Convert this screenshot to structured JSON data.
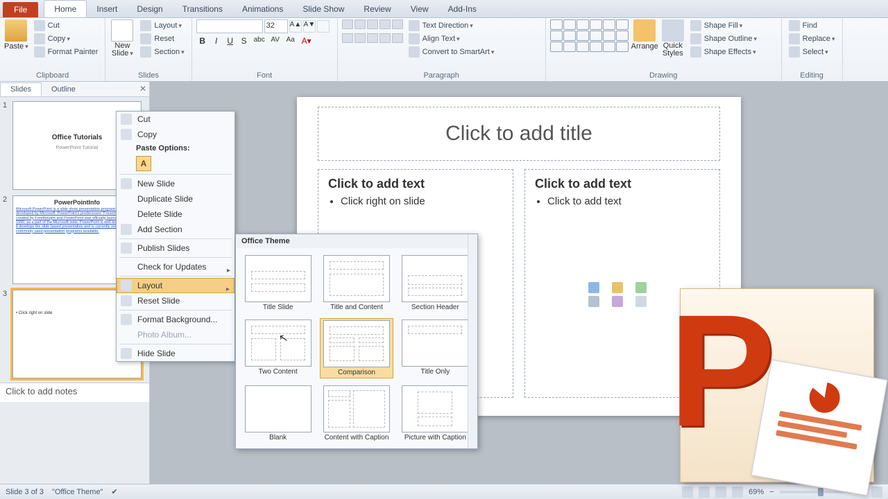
{
  "tabs": {
    "file": "File",
    "home": "Home",
    "insert": "Insert",
    "design": "Design",
    "transitions": "Transitions",
    "animations": "Animations",
    "slideshow": "Slide Show",
    "review": "Review",
    "view": "View",
    "addins": "Add-Ins"
  },
  "ribbon": {
    "clipboard": {
      "paste": "Paste",
      "cut": "Cut",
      "copy": "Copy",
      "painter": "Format Painter",
      "label": "Clipboard"
    },
    "slides": {
      "newslide": "New Slide",
      "layout": "Layout",
      "reset": "Reset",
      "section": "Section",
      "label": "Slides"
    },
    "font": {
      "size": "32",
      "label": "Font"
    },
    "paragraph": {
      "textdir": "Text Direction",
      "align": "Align Text",
      "smartart": "Convert to SmartArt",
      "label": "Paragraph"
    },
    "drawing": {
      "arrange": "Arrange",
      "quick": "Quick Styles",
      "fill": "Shape Fill",
      "outline": "Shape Outline",
      "effects": "Shape Effects",
      "label": "Drawing"
    },
    "editing": {
      "find": "Find",
      "replace": "Replace",
      "select": "Select",
      "label": "Editing"
    }
  },
  "pane": {
    "slides": "Slides",
    "outline": "Outline"
  },
  "thumbs": {
    "1": {
      "title": "Office Tutorials",
      "sub": "PowerPoint Tutorial"
    },
    "2": {
      "title": "PowerPointInfo",
      "body": "Microsoft PowerPoint is a slide show presentation program currently developed by Microsoft. PowerPoint's predecessor 'Presenter' was created by Forethought and PowerPoint was officially launched May 22, 1990, as a part of the Microsoft suite. PowerPoint is well-known for how it develops the slide based presentation and is currently one of the most commonly used presentation programs available."
    },
    "3": {
      "body": "Click right on slide"
    }
  },
  "notes": "Click to add notes",
  "slide": {
    "title": "Click to add title",
    "leftHead": "Click to add text",
    "leftItem": "Click right on slide",
    "rightHead": "Click to add text",
    "rightItem": "Click to add text"
  },
  "ctx": {
    "cut": "Cut",
    "copy": "Copy",
    "pasteopts": "Paste Options:",
    "newslide": "New Slide",
    "dup": "Duplicate Slide",
    "del": "Delete Slide",
    "addsec": "Add Section",
    "publish": "Publish Slides",
    "updates": "Check for Updates",
    "layout": "Layout",
    "reset": "Reset Slide",
    "format": "Format Background...",
    "album": "Photo Album...",
    "hide": "Hide Slide"
  },
  "flyout": {
    "head": "Office Theme",
    "items": [
      "Title Slide",
      "Title and Content",
      "Section Header",
      "Two Content",
      "Comparison",
      "Title Only",
      "Blank",
      "Content with Caption",
      "Picture with Caption"
    ]
  },
  "status": {
    "slide": "Slide 3 of 3",
    "theme": "\"Office Theme\"",
    "zoom": "69%"
  }
}
